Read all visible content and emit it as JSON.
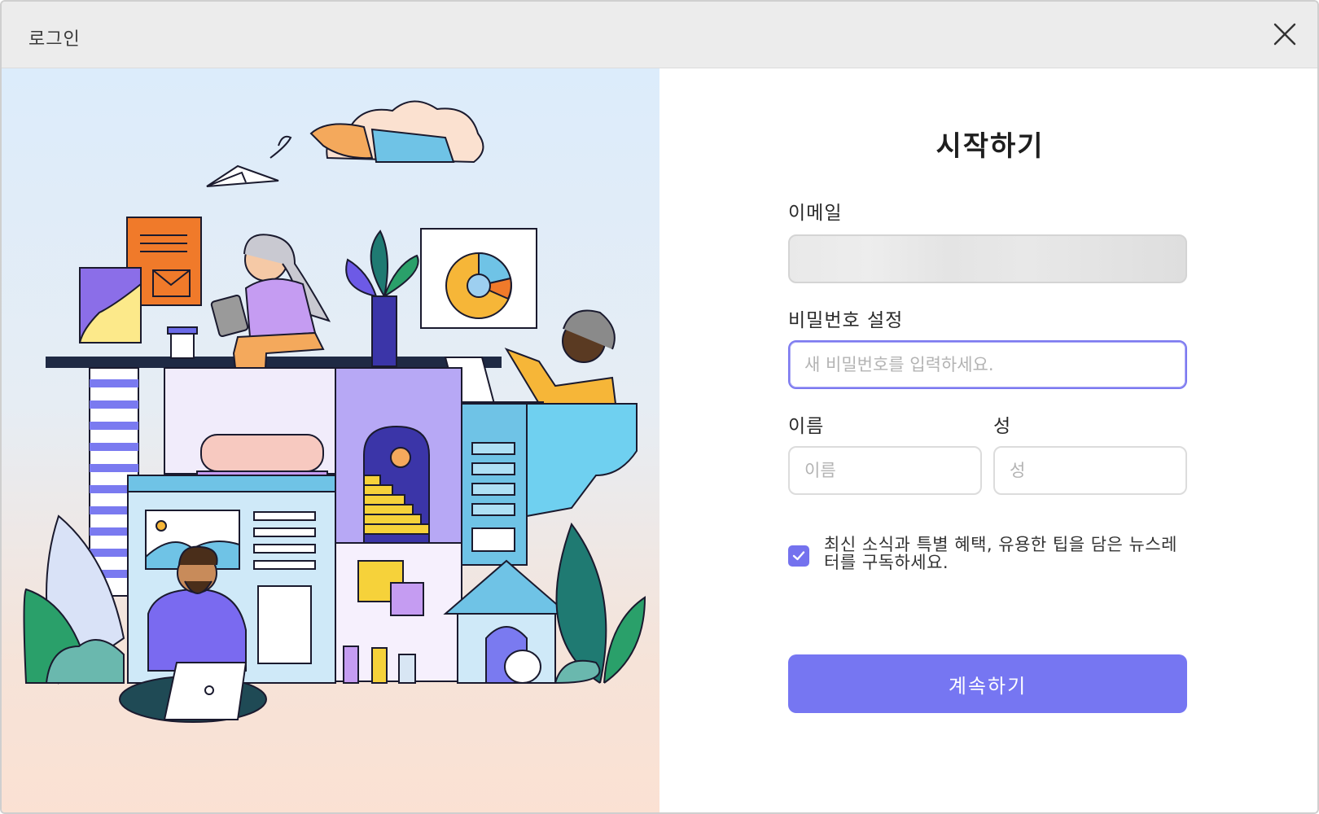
{
  "window": {
    "title": "로그인"
  },
  "form": {
    "heading": "시작하기",
    "email_label": "이메일",
    "email_value": "",
    "password_label": "비밀번호 설정",
    "password_placeholder": "새 비밀번호를 입력하세요.",
    "first_name_label": "이름",
    "first_name_placeholder": "이름",
    "last_name_label": "성",
    "last_name_placeholder": "성",
    "newsletter_label": "최신 소식과 특별 혜택, 유용한 팁을 담은 뉴스레터를 구독하세요.",
    "newsletter_checked": true,
    "continue_label": "계속하기"
  },
  "colors": {
    "accent": "#7676f2",
    "checkbox": "#7472ee",
    "focus_border": "#7d7af0"
  },
  "icons": {
    "close": "close-icon",
    "check": "check-icon"
  }
}
